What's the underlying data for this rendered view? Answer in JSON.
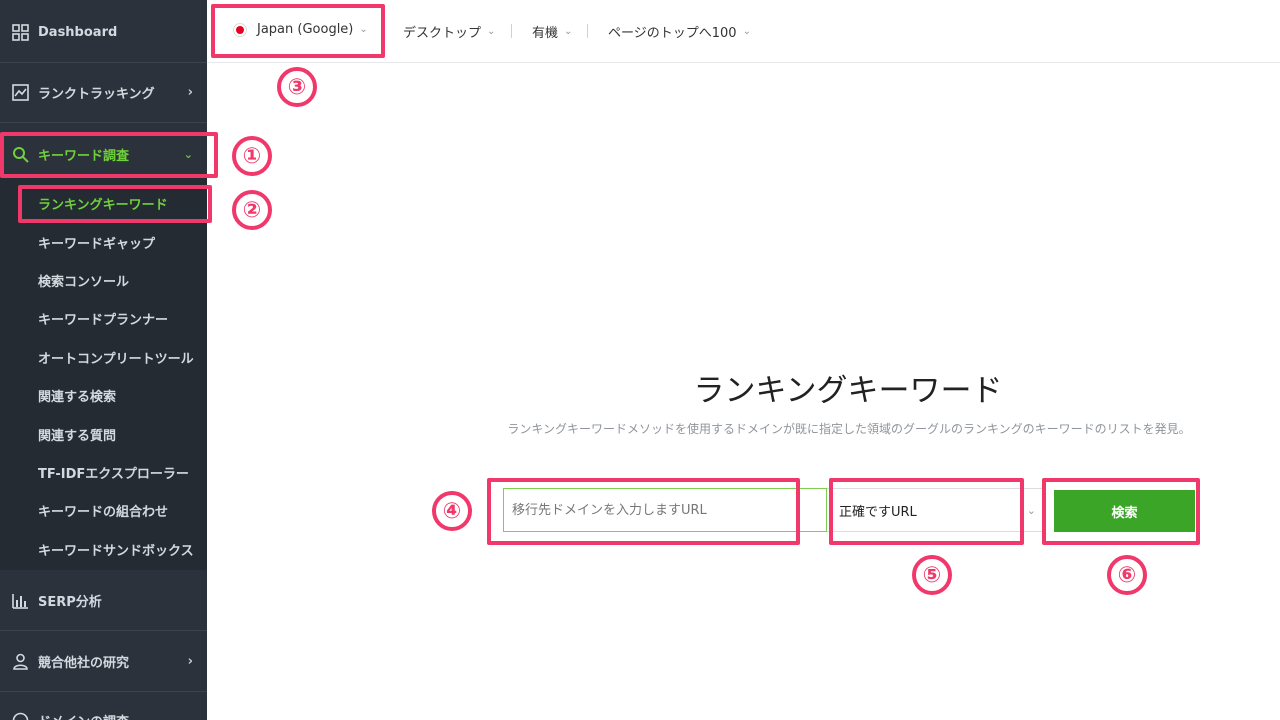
{
  "sidebar": {
    "dashboard": "Dashboard",
    "rank_tracking": "ランクトラッキング",
    "keyword_research": "キーワード調査",
    "sub_items": [
      "ランキングキーワード",
      "キーワードギャップ",
      "検索コンソール",
      "キーワードプランナー",
      "オートコンプリートツール",
      "関連する検索",
      "関連する質問",
      "TF-IDFエクスプローラー",
      "キーワードの組合わせ",
      "キーワードサンドボックス"
    ],
    "serp": "SERP分析",
    "competitor": "競合他社の研究",
    "domain": "ドメインの調査"
  },
  "topbar": {
    "region": "Japan (Google)",
    "device": "デスクトップ",
    "type": "有機",
    "depth": "ページのトップへ100"
  },
  "main": {
    "title": "ランキングキーワード",
    "description": "ランキングキーワードメソッドを使用するドメインが既に指定した領域のグーグルのランキングのキーワードのリストを発見。",
    "url_placeholder": "移行先ドメインを入力しますURL",
    "match_select": "正確ですURL",
    "search_button": "検索"
  },
  "annotations": [
    "①",
    "②",
    "③",
    "④",
    "⑤",
    "⑥"
  ],
  "colors": {
    "sidebar_bg": "#2b323b",
    "accent_green": "#6fd13a",
    "button_green": "#3aa526",
    "highlight_pink": "#f0386b"
  }
}
